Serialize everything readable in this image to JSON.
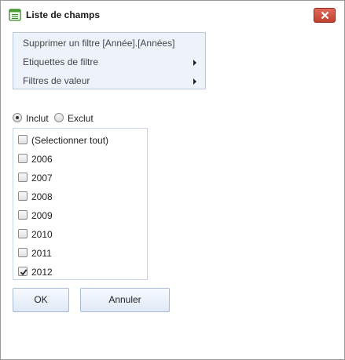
{
  "window": {
    "title": "Liste de champs",
    "title_icon": "field-list-icon",
    "close_icon": "close-icon"
  },
  "menu": {
    "items": [
      {
        "label": "Supprimer un filtre [Année].[Années]",
        "has_submenu": false
      },
      {
        "label": "Etiquettes de filtre",
        "has_submenu": true
      },
      {
        "label": "Filtres de valeur",
        "has_submenu": true
      }
    ]
  },
  "filter_mode": {
    "include_label": "Inclut",
    "exclude_label": "Exclut",
    "selected": "include"
  },
  "checklist": {
    "items": [
      {
        "label": "(Selectionner tout)",
        "checked": false
      },
      {
        "label": "2006",
        "checked": false
      },
      {
        "label": "2007",
        "checked": false
      },
      {
        "label": "2008",
        "checked": false
      },
      {
        "label": "2009",
        "checked": false
      },
      {
        "label": "2010",
        "checked": false
      },
      {
        "label": "2011",
        "checked": false
      },
      {
        "label": "2012",
        "checked": true
      }
    ]
  },
  "buttons": {
    "ok_label": "OK",
    "cancel_label": "Annuler"
  }
}
